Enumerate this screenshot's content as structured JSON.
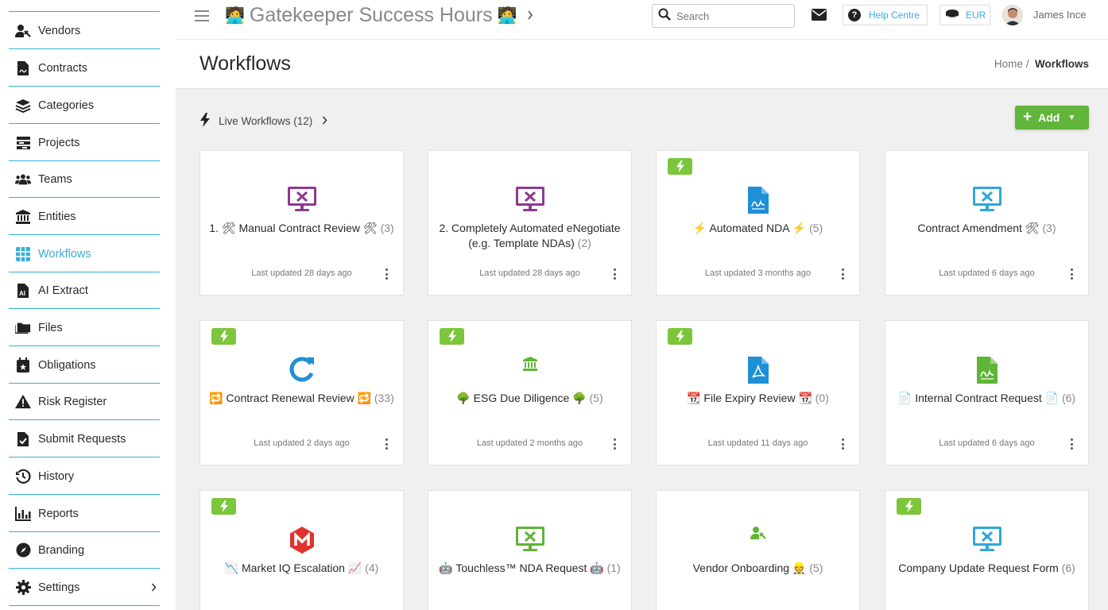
{
  "sidebar": {
    "items": [
      {
        "label": "Vendors",
        "icon": "vendor-icon"
      },
      {
        "label": "Contracts",
        "icon": "contract-icon"
      },
      {
        "label": "Categories",
        "icon": "layers-icon"
      },
      {
        "label": "Projects",
        "icon": "projects-icon"
      },
      {
        "label": "Teams",
        "icon": "users-icon"
      },
      {
        "label": "Entities",
        "icon": "bank-icon"
      },
      {
        "label": "Workflows",
        "icon": "grid-icon"
      },
      {
        "label": "AI Extract",
        "icon": "ai-file-icon"
      },
      {
        "label": "Files",
        "icon": "folder-icon"
      },
      {
        "label": "Obligations",
        "icon": "calendar-star-icon"
      },
      {
        "label": "Risk Register",
        "icon": "warning-icon"
      },
      {
        "label": "Submit Requests",
        "icon": "file-check-icon"
      },
      {
        "label": "History",
        "icon": "history-icon"
      },
      {
        "label": "Reports",
        "icon": "bar-chart-icon"
      },
      {
        "label": "Branding",
        "icon": "compass-icon"
      },
      {
        "label": "Settings",
        "icon": "gear-icon"
      }
    ],
    "active": "Workflows",
    "accent": "#2eb3d1"
  },
  "topbar": {
    "title": "Gatekeeper Success Hours",
    "title_emoji": "🧑‍💻",
    "search_placeholder": "Search",
    "help_label": "Help Centre",
    "currency": "EUR",
    "user_name": "James Ince"
  },
  "header": {
    "page_title": "Workflows",
    "breadcrumb_home": "Home",
    "breadcrumb_sep": "/",
    "breadcrumb_current": "Workflows"
  },
  "toolbar": {
    "live_label": "Live Workflows (12)",
    "add_label": "Add",
    "add_color": "#61b53b"
  },
  "cards": [
    {
      "title": "1. 🛠 Manual Contract Review 🛠",
      "count": "(3)",
      "updated": "Last updated 28 days ago",
      "icon": "presentation-tools-icon",
      "icon_color": "#8e3a8e",
      "live": false
    },
    {
      "title": "2. Completely Automated eNegotiate (e.g. Template NDAs)",
      "count": "(2)",
      "updated": "Last updated 28 days ago",
      "icon": "presentation-tools-icon",
      "icon_color": "#8e3a8e",
      "live": false
    },
    {
      "title": "⚡ Automated NDA ⚡",
      "count": "(5)",
      "updated": "Last updated 3 months ago",
      "icon": "signature-file-icon",
      "icon_color": "#1f8fd6",
      "live": true
    },
    {
      "title": "Contract Amendment 🛠",
      "count": "(3)",
      "updated": "Last updated 6 days ago",
      "icon": "presentation-tools-icon",
      "icon_color": "#2ea7d9",
      "live": false
    },
    {
      "title": "🔁 Contract Renewal Review 🔁",
      "count": "(33)",
      "updated": "Last updated 2 days ago",
      "icon": "refresh-icon",
      "icon_color": "#1f8fd6",
      "live": true
    },
    {
      "title": "🌳 ESG Due Diligence 🌳",
      "count": "(5)",
      "updated": "Last updated 2 months ago",
      "icon": "bank-icon",
      "icon_color": "#5fb536",
      "live": true
    },
    {
      "title": "📆 File Expiry Review 📆",
      "count": "(0)",
      "updated": "Last updated 11 days ago",
      "icon": "pdf-file-icon",
      "icon_color": "#1f8fd6",
      "live": true
    },
    {
      "title": "📄 Internal Contract Request 📄",
      "count": "(6)",
      "updated": "Last updated 6 days ago",
      "icon": "signature-file-icon",
      "icon_color": "#5fb536",
      "live": false
    },
    {
      "title": "📉 Market IQ Escalation 📈",
      "count": "(4)",
      "updated": "",
      "icon": "market-iq-icon",
      "icon_color": "#e0312d",
      "live": true
    },
    {
      "title": "🤖 Touchless™ NDA Request 🤖",
      "count": "(1)",
      "updated": "",
      "icon": "presentation-tools-icon",
      "icon_color": "#5fb536",
      "live": false
    },
    {
      "title": "Vendor Onboarding 👷",
      "count": "(5)",
      "updated": "",
      "icon": "vendor-icon",
      "icon_color": "#5fb536",
      "live": false
    },
    {
      "title": "Company Update Request Form",
      "count": "(6)",
      "updated": "",
      "icon": "presentation-tools-icon",
      "icon_color": "#2ea7d9",
      "live": true
    }
  ]
}
